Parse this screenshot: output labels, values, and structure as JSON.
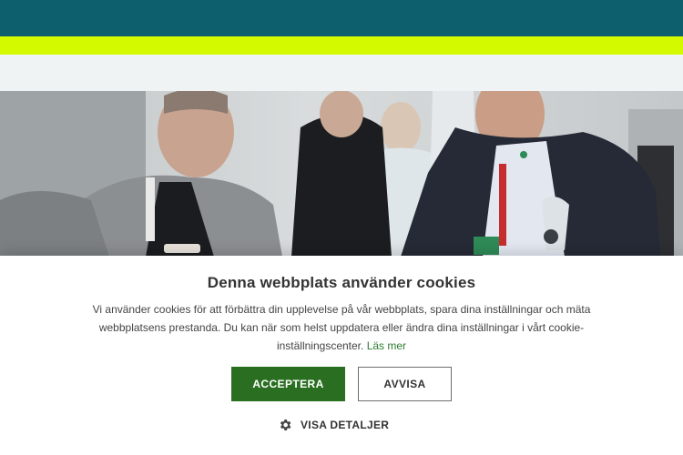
{
  "header": {
    "brand_color": "#0e5f6e",
    "accent_color": "#d4fa00"
  },
  "hero": {
    "image_description_icon": "photo-people-networking"
  },
  "cookie_banner": {
    "title": "Denna webbplats använder cookies",
    "text": "Vi använder cookies för att förbättra din upplevelse på vår webbplats, spara dina inställningar och mäta webbplatsens prestanda. Du kan när som helst uppdatera eller ändra dina inställningar i vårt cookie-inställningscenter.",
    "read_more": "Läs mer",
    "accept_label": "ACCEPTERA",
    "reject_label": "AVVISA",
    "details_label": "VISA DETALJER",
    "details_icon": "gear-icon",
    "accept_color": "#2a6f21"
  }
}
